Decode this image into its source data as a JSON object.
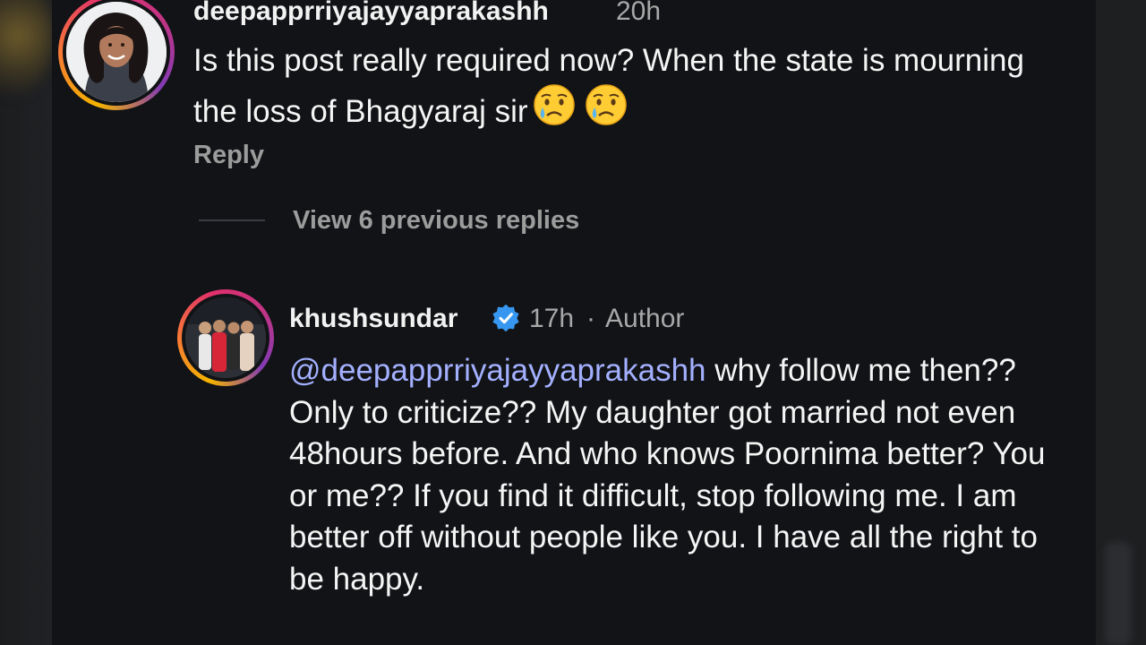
{
  "comment1": {
    "username": "deepapprriyajayyaprakashh",
    "time": "20h",
    "text": "Is this post really required now? When the state is mourning the loss of Bhagyaraj sir",
    "emojis": [
      "crying-face",
      "crying-face"
    ],
    "reply_label": "Reply"
  },
  "thread": {
    "view_replies_label": "View 6 previous replies"
  },
  "comment2": {
    "username": "khushsundar",
    "verified": true,
    "time": "17h",
    "separator": "·",
    "author_label": "Author",
    "mention": "@deepapprriyajayyaprakashh",
    "text": " why follow me then?? Only to criticize?? My daughter got married not even 48hours before. And who knows Poornima better? You or me?? If you find it difficult, stop following me. I am better off without people like you. I have all the right to be happy."
  },
  "colors": {
    "background": "#111316",
    "mention": "#a3b0ff",
    "verified": "#3797f0",
    "secondary_text": "#a8a8a8"
  }
}
